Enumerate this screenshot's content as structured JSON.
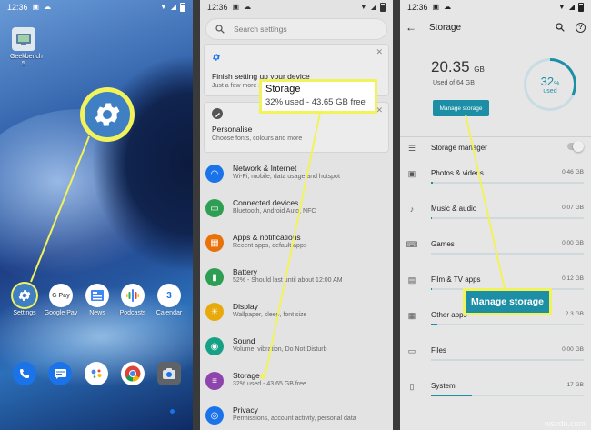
{
  "home": {
    "time": "12:36",
    "apps": {
      "geekbench": "Geekbench 5",
      "settings": "Settings",
      "gpay": "Google Pay",
      "news": "News",
      "podcasts": "Podcasts",
      "calendar": "Calendar"
    },
    "gpay_icon_text": "G Pay",
    "calendar_icon_text": "3"
  },
  "settings": {
    "time": "12:36",
    "search_placeholder": "Search settings",
    "setup_card": {
      "title": "Finish setting up your device",
      "subtitle": "Just a few more st"
    },
    "personalise_card": {
      "title": "Personalise",
      "subtitle": "Choose fonts, colours and more"
    },
    "items": [
      {
        "title": "Network & Internet",
        "subtitle": "Wi-Fi, mobile, data usage and hotspot",
        "color": "#1a73e8",
        "icon": "wifi-icon"
      },
      {
        "title": "Connected devices",
        "subtitle": "Bluetooth, Android Auto, NFC",
        "color": "#2e9e52",
        "icon": "devices-icon"
      },
      {
        "title": "Apps & notifications",
        "subtitle": "Recent apps, default apps",
        "color": "#e8710a",
        "icon": "apps-icon"
      },
      {
        "title": "Battery",
        "subtitle": "52% - Should last until about 12:00 AM",
        "color": "#2e9e52",
        "icon": "battery-icon"
      },
      {
        "title": "Display",
        "subtitle": "Wallpaper, sleep, font size",
        "color": "#e8a90a",
        "icon": "display-icon"
      },
      {
        "title": "Sound",
        "subtitle": "Volume, vibration, Do Not Disturb",
        "color": "#16a085",
        "icon": "sound-icon"
      },
      {
        "title": "Storage",
        "subtitle": "32% used - 43.65 GB free",
        "color": "#8e44ad",
        "icon": "storage-icon"
      },
      {
        "title": "Privacy",
        "subtitle": "Permissions, account activity, personal data",
        "color": "#1a73e8",
        "icon": "privacy-icon"
      }
    ],
    "callout": {
      "title": "Storage",
      "subtitle": "32% used - 43.65 GB free"
    }
  },
  "storage": {
    "time": "12:36",
    "title": "Storage",
    "used_value": "20.35",
    "used_unit": "GB",
    "used_of": "Used of 64 GB",
    "manage_button": "Manage storage",
    "percent_value": "32",
    "percent_unit": "%",
    "percent_fraction": 0.32,
    "percent_label": "used",
    "manager_label": "Storage manager",
    "categories": [
      {
        "name": "Photos & videos",
        "value": "0.46 GB",
        "fill": 0.01
      },
      {
        "name": "Music & audio",
        "value": "0.07 GB",
        "fill": 0.005
      },
      {
        "name": "Games",
        "value": "0.00 GB",
        "fill": 0
      },
      {
        "name": "Film & TV apps",
        "value": "0.12 GB",
        "fill": 0.005
      },
      {
        "name": "Other apps",
        "value": "2.3 GB",
        "fill": 0.04
      },
      {
        "name": "Files",
        "value": "0.00 GB",
        "fill": 0
      },
      {
        "name": "System",
        "value": "17 GB",
        "fill": 0.27
      }
    ],
    "manage_callout": "Manage storage"
  },
  "colors": {
    "highlight": "#f2f25a",
    "accent": "#1c8fa6"
  },
  "watermark": "wsxdn.com"
}
